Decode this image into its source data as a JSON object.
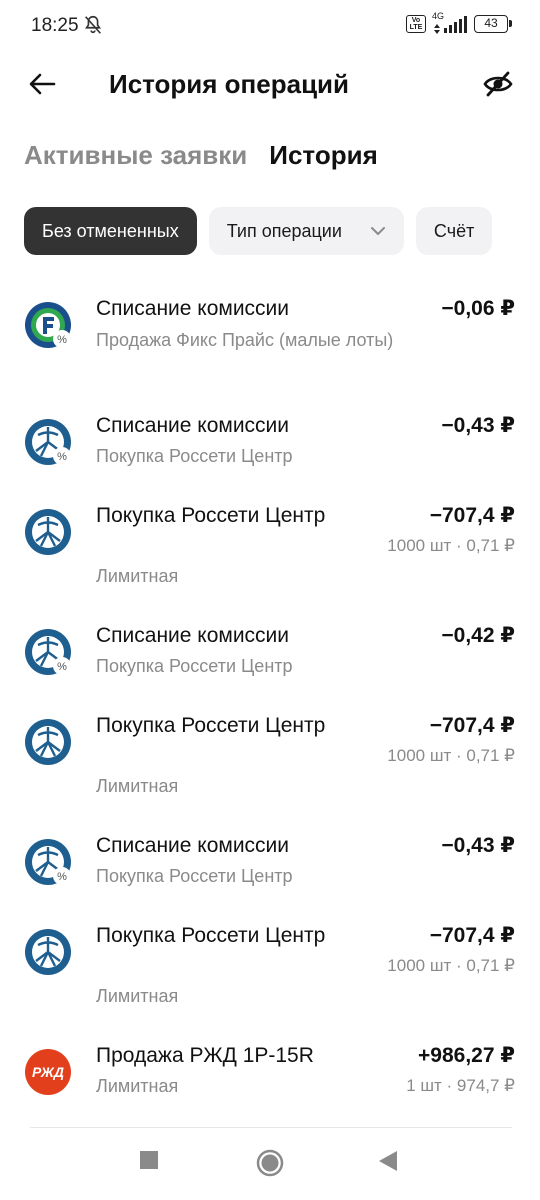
{
  "status": {
    "time": "18:25",
    "volte": "Vo LTE",
    "network": "4G",
    "battery": "43"
  },
  "header": {
    "title": "История операций"
  },
  "tabs": [
    {
      "label": "Активные заявки",
      "active": false
    },
    {
      "label": "История",
      "active": true
    }
  ],
  "filters": [
    {
      "label": "Без отмененных",
      "selected": true
    },
    {
      "label": "Тип операции",
      "selected": false
    },
    {
      "label": "Счёт",
      "selected": false
    }
  ],
  "operations": [
    {
      "icon": "fix-price-commission-icon",
      "title": "Списание комиссии",
      "subtitle": "Продажа Фикс Прайс (малые лоты)",
      "amount": "−0,06 ₽",
      "details": ""
    },
    {
      "icon": "rosseti-commission-icon",
      "title": "Списание комиссии",
      "subtitle": "Покупка Россети Центр",
      "amount": "−0,43 ₽",
      "details": ""
    },
    {
      "icon": "rosseti-icon",
      "title": "Покупка Россети Центр",
      "subtitle": "Лимитная",
      "amount": "−707,4 ₽",
      "details": "1000 шт · 0,71 ₽"
    },
    {
      "icon": "rosseti-commission-icon",
      "title": "Списание комиссии",
      "subtitle": "Покупка Россети Центр",
      "amount": "−0,42 ₽",
      "details": ""
    },
    {
      "icon": "rosseti-icon",
      "title": "Покупка Россети Центр",
      "subtitle": "Лимитная",
      "amount": "−707,4 ₽",
      "details": "1000 шт · 0,71 ₽"
    },
    {
      "icon": "rosseti-commission-icon",
      "title": "Списание комиссии",
      "subtitle": "Покупка Россети Центр",
      "amount": "−0,43 ₽",
      "details": ""
    },
    {
      "icon": "rosseti-icon",
      "title": "Покупка Россети Центр",
      "subtitle": "Лимитная",
      "amount": "−707,4 ₽",
      "details": "1000 шт · 0,71 ₽"
    },
    {
      "icon": "rzd-icon",
      "title": "Продажа РЖД 1Р-15R",
      "subtitle": "Лимитная",
      "amount": "+986,27 ₽",
      "details": "1 шт · 974,7 ₽"
    }
  ],
  "colors": {
    "rosseti_blue": "#1f5f8f",
    "fix_price_green": "#2fa84f",
    "rzd_red": "#e2401c",
    "chip_dark": "#333333",
    "chip_light": "#f2f2f4",
    "muted_text": "#8a8a8a"
  }
}
